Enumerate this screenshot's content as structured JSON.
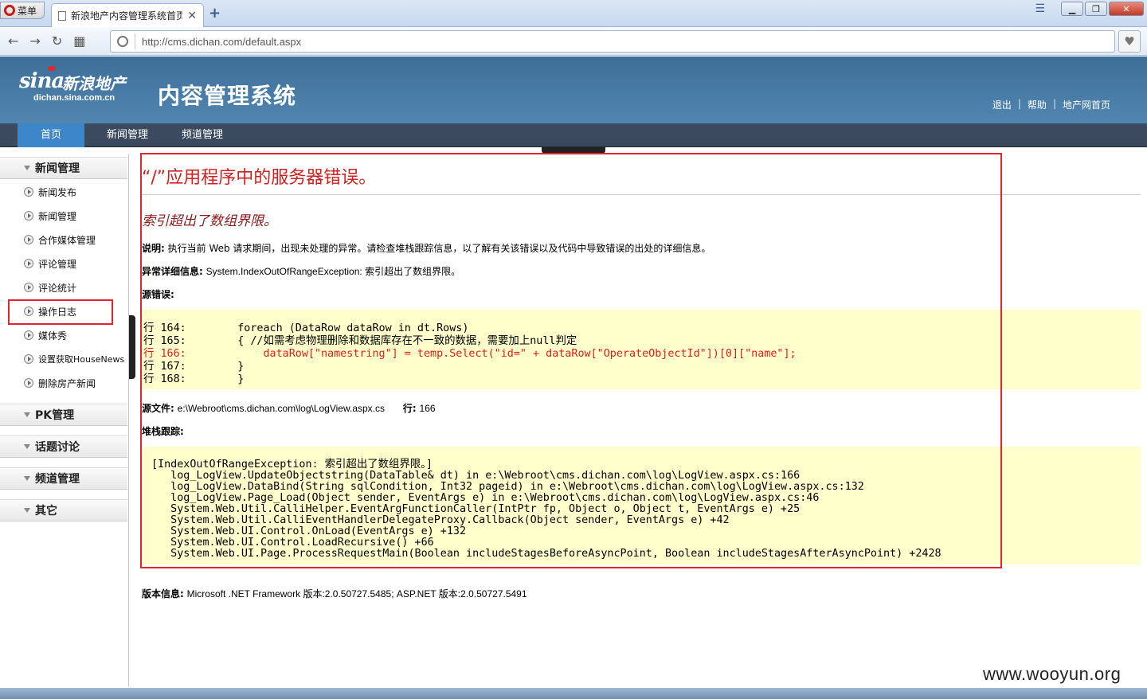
{
  "browser": {
    "menu_label": "菜单",
    "tab_title": "新浪地产内容管理系统首页",
    "tab_close": "✕",
    "new_tab": "+",
    "url": "http://cms.dichan.com/default.aspx",
    "url_domain": "cms.dichan.com"
  },
  "header": {
    "logo_sina": "sina",
    "logo_cn": "新浪地产",
    "logo_domain": "dichan.sina.com.cn",
    "system_title": "内容管理系统",
    "links": [
      "退出",
      "帮助",
      "地产网首页"
    ]
  },
  "navbar": {
    "items": [
      "首页",
      "新闻管理",
      "频道管理"
    ]
  },
  "sidebar": {
    "groups": [
      {
        "label": "新闻管理",
        "items": [
          "新闻发布",
          "新闻管理",
          "合作媒体管理",
          "评论管理",
          "评论统计",
          "操作日志",
          "媒体秀",
          "设置获取HouseNews",
          "删除房产新闻"
        ]
      },
      {
        "label": "PK管理"
      },
      {
        "label": "话题讨论"
      },
      {
        "label": "频道管理"
      },
      {
        "label": "其它"
      }
    ]
  },
  "error": {
    "title": "“/”应用程序中的服务器错误。",
    "subtitle": "索引超出了数组界限。",
    "desc_label": "说明:",
    "desc_text": "执行当前 Web 请求期间，出现未处理的异常。请检查堆栈跟踪信息，以了解有关该错误以及代码中导致错误的出处的详细信息。",
    "detail_label": "异常详细信息:",
    "detail_text": "System.IndexOutOfRangeException: 索引超出了数组界限。",
    "source_label": "源错误:",
    "source_lines": [
      "行 164:        foreach (DataRow dataRow in dt.Rows)",
      "行 165:        { //如需考虑物理删除和数据库存在不一致的数据，需要加上null判定",
      "行 166:            dataRow[\"namestring\"] = temp.Select(\"id=\" + dataRow[\"OperateObjectId\"])[0][\"name\"];",
      "行 167:        }",
      "行 168:        }"
    ],
    "source_file_label": "源文件:",
    "source_file": "e:\\Webroot\\cms.dichan.com\\log\\LogView.aspx.cs",
    "line_label": "行:",
    "line_value": "166",
    "stack_label": "堆栈跟踪:",
    "stack_lines": [
      "[IndexOutOfRangeException: 索引超出了数组界限。]",
      "   log_LogView.UpdateObjectstring(DataTable& dt) in e:\\Webroot\\cms.dichan.com\\log\\LogView.aspx.cs:166",
      "   log_LogView.DataBind(String sqlCondition, Int32 pageid) in e:\\Webroot\\cms.dichan.com\\log\\LogView.aspx.cs:132",
      "   log_LogView.Page_Load(Object sender, EventArgs e) in e:\\Webroot\\cms.dichan.com\\log\\LogView.aspx.cs:46",
      "   System.Web.Util.CalliHelper.EventArgFunctionCaller(IntPtr fp, Object o, Object t, EventArgs e) +25",
      "   System.Web.Util.CalliEventHandlerDelegateProxy.Callback(Object sender, EventArgs e) +42",
      "   System.Web.UI.Control.OnLoad(EventArgs e) +132",
      "   System.Web.UI.Control.LoadRecursive() +66",
      "   System.Web.UI.Page.ProcessRequestMain(Boolean includeStagesBeforeAsyncPoint, Boolean includeStagesAfterAsyncPoint) +2428"
    ],
    "version_label": "版本信息:",
    "version_text": "Microsoft .NET Framework 版本:2.0.50727.5485; ASP.NET 版本:2.0.50727.5491"
  },
  "watermark": "www.wooyun.org",
  "colors": {
    "error_red": "#d02020",
    "highlight_box": "#e0252d",
    "code_bg": "#ffffcc",
    "header_blue": "#3c6e98",
    "nav_active": "#3c86c9"
  }
}
